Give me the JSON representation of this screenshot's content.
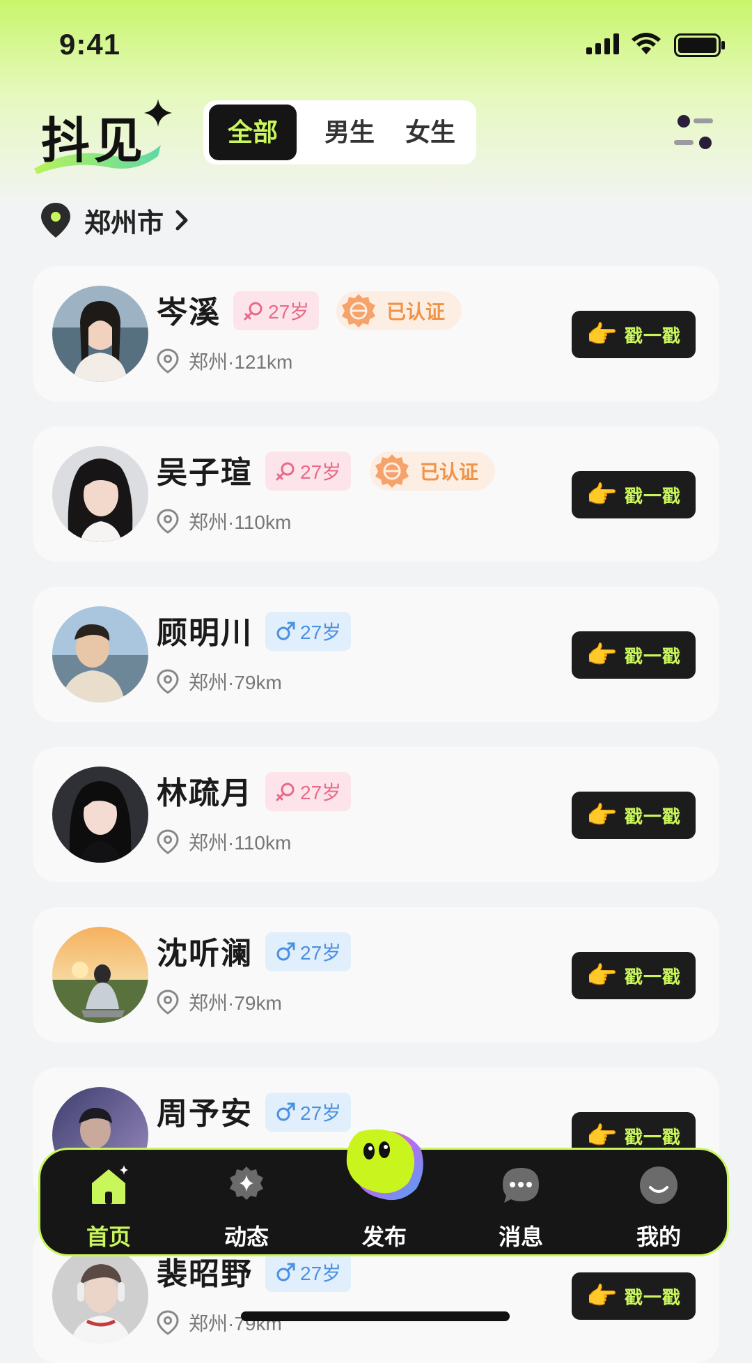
{
  "status_bar": {
    "time": "9:41"
  },
  "header": {
    "logo_text": "抖见",
    "tabs": [
      {
        "label": "全部",
        "active": true
      },
      {
        "label": "男生",
        "active": false
      },
      {
        "label": "女生",
        "active": false
      }
    ]
  },
  "location": {
    "city": "郑州市"
  },
  "users": [
    {
      "name": "岑溪",
      "gender": "female",
      "age": "27岁",
      "verified": true,
      "verified_label": "已认证",
      "distance": "郑州·121km"
    },
    {
      "name": "吴子瑄",
      "gender": "female",
      "age": "27岁",
      "verified": true,
      "verified_label": "已认证",
      "distance": "郑州·110km"
    },
    {
      "name": "顾明川",
      "gender": "male",
      "age": "27岁",
      "verified": false,
      "distance": "郑州·79km"
    },
    {
      "name": "林疏月",
      "gender": "female",
      "age": "27岁",
      "verified": false,
      "distance": "郑州·110km"
    },
    {
      "name": "沈听澜",
      "gender": "male",
      "age": "27岁",
      "verified": false,
      "distance": "郑州·79km"
    },
    {
      "name": "周予安",
      "gender": "male",
      "age": "27岁",
      "verified": false,
      "distance": ""
    },
    {
      "name": "裴昭野",
      "gender": "male",
      "age": "27岁",
      "verified": false,
      "distance": "郑州·79km"
    }
  ],
  "poke_label": "戳一戳",
  "bottom_nav": [
    {
      "label": "首页",
      "icon": "home-icon",
      "active": true
    },
    {
      "label": "动态",
      "icon": "sparkle-icon",
      "active": false
    },
    {
      "label": "发布",
      "icon": "blob-mascot-icon",
      "active": false
    },
    {
      "label": "消息",
      "icon": "message-icon",
      "active": false
    },
    {
      "label": "我的",
      "icon": "profile-icon",
      "active": false
    }
  ],
  "colors": {
    "accent": "#C9F75B",
    "female_bg": "#FDE4EA",
    "female_fg": "#E86A87",
    "male_bg": "#E1EEFB",
    "male_fg": "#4A90E2",
    "verified_fg": "#F09346"
  }
}
